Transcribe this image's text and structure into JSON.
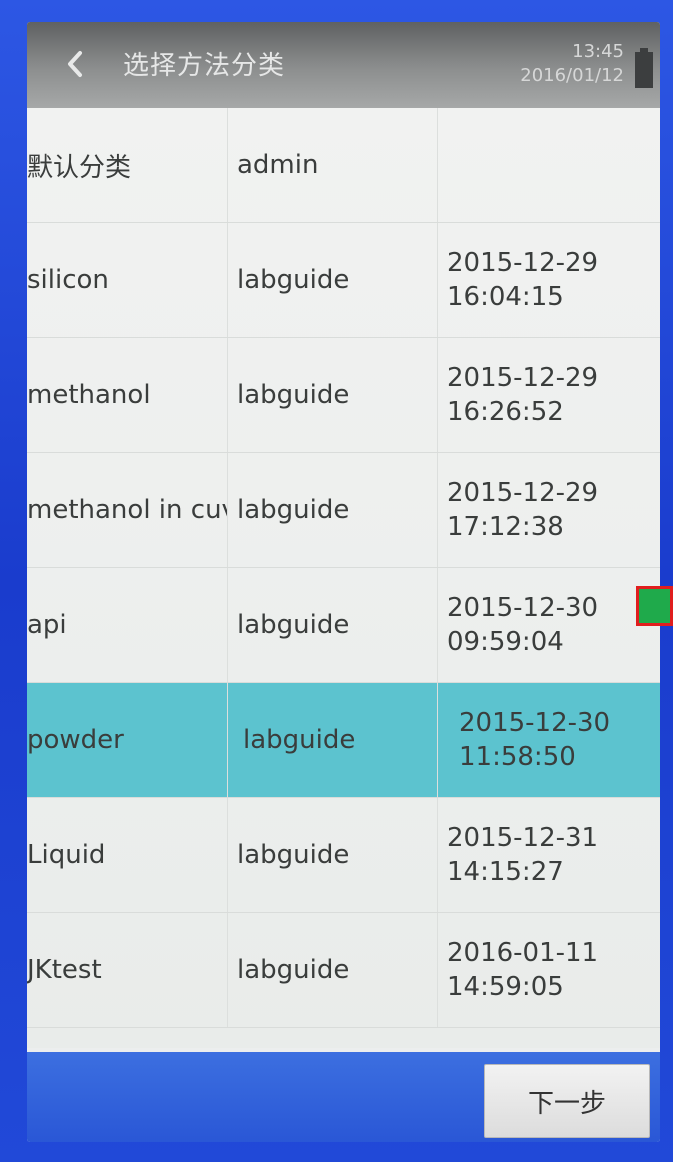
{
  "header": {
    "title": "选择方法分类",
    "time": "13:45",
    "date": "2016/01/12",
    "back_icon": "chevron-left-icon",
    "battery_icon": "battery-icon"
  },
  "table": {
    "rows": [
      {
        "name": "默认分类",
        "author": "admin",
        "date": "",
        "time": "",
        "selected": false
      },
      {
        "name": "silicon",
        "author": "labguide",
        "date": "2015-12-29",
        "time": "16:04:15",
        "selected": false
      },
      {
        "name": "methanol",
        "author": "labguide",
        "date": "2015-12-29",
        "time": "16:26:52",
        "selected": false
      },
      {
        "name": "methanol in cuv",
        "author": "labguide",
        "date": "2015-12-29",
        "time": "17:12:38",
        "selected": false
      },
      {
        "name": "api",
        "author": "labguide",
        "date": "2015-12-30",
        "time": "09:59:04",
        "selected": false
      },
      {
        "name": "powder",
        "author": "labguide",
        "date": "2015-12-30",
        "time": "11:58:50",
        "selected": true
      },
      {
        "name": "Liquid",
        "author": "labguide",
        "date": "2015-12-31",
        "time": "14:15:27",
        "selected": false
      },
      {
        "name": "JKtest",
        "author": "labguide",
        "date": "2016-01-11",
        "time": "14:59:05",
        "selected": false
      }
    ]
  },
  "footer": {
    "next_label": "下一步"
  },
  "colors": {
    "selected_row": "#5cc3cf",
    "frame": "#1b3fd0",
    "marker_fill": "#1faa4b",
    "marker_border": "#e01e1e"
  }
}
